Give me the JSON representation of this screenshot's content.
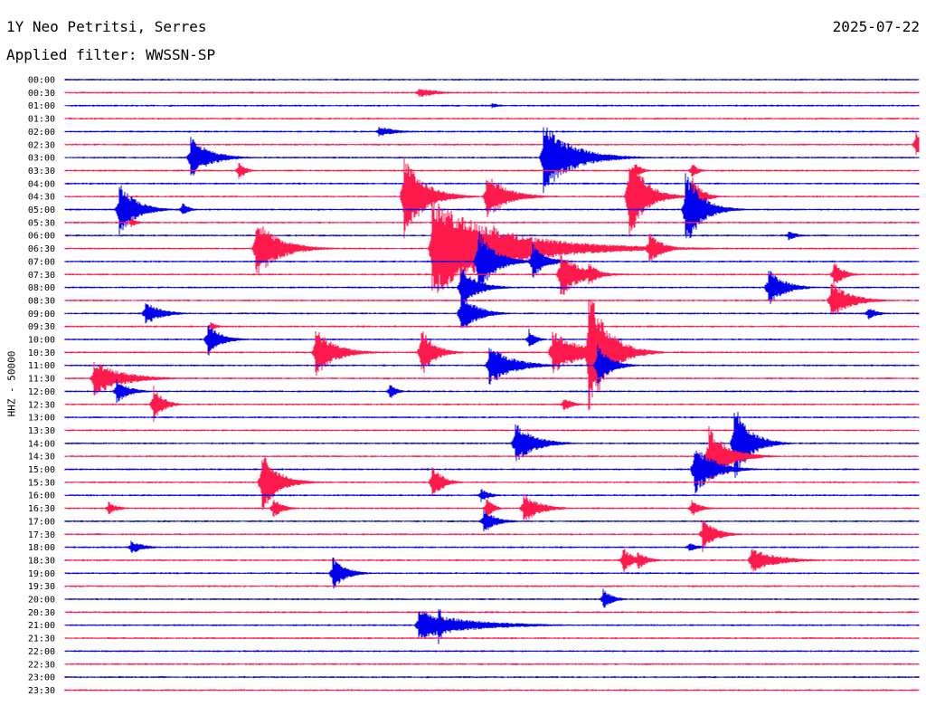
{
  "header": {
    "station": "1Y Neo Petritsi, Serres",
    "date": "2025-07-22",
    "filter_label": "Applied filter: WWSSN-SP"
  },
  "channel_label": "HHZ - 50000",
  "colors": {
    "blue_trace": "#0000ee",
    "red_trace": "#ff1a4d",
    "text": "#000000",
    "background": "#ffffff"
  },
  "chart_data": {
    "type": "line",
    "title": "1Y Neo Petritsi, Serres",
    "ylabel": "HHZ - 50000",
    "time_labels": [
      "00:00",
      "00:30",
      "01:00",
      "01:30",
      "02:00",
      "02:30",
      "03:00",
      "03:30",
      "04:00",
      "04:30",
      "05:00",
      "05:30",
      "06:00",
      "06:30",
      "07:00",
      "07:30",
      "08:00",
      "08:30",
      "09:00",
      "09:30",
      "10:00",
      "10:30",
      "11:00",
      "11:30",
      "12:00",
      "12:30",
      "13:00",
      "13:30",
      "14:00",
      "14:30",
      "15:00",
      "15:30",
      "16:00",
      "16:30",
      "17:00",
      "17:30",
      "18:00",
      "18:30",
      "19:00",
      "19:30",
      "20:00",
      "20:30",
      "21:00",
      "21:30",
      "22:00",
      "22:30",
      "23:00",
      "23:30"
    ],
    "trace_colors": [
      "blue_trace",
      "red_trace"
    ],
    "trace_minutes": 30,
    "events": [
      {
        "trace": 1,
        "minute": 12.4,
        "amp": 6,
        "dur": 1.2
      },
      {
        "trace": 2,
        "minute": 15.0,
        "amp": 3,
        "dur": 0.6
      },
      {
        "trace": 4,
        "minute": 11.0,
        "amp": 6,
        "dur": 1.2
      },
      {
        "trace": 5,
        "minute": 29.9,
        "amp": 18,
        "dur": 0.3
      },
      {
        "trace": 6,
        "minute": 4.4,
        "amp": 24,
        "dur": 1.2
      },
      {
        "trace": 6,
        "minute": 16.8,
        "amp": 40,
        "dur": 1.8
      },
      {
        "trace": 7,
        "minute": 6.1,
        "amp": 12,
        "dur": 0.4
      },
      {
        "trace": 7,
        "minute": 20.0,
        "amp": 12,
        "dur": 0.4
      },
      {
        "trace": 7,
        "minute": 22.0,
        "amp": 10,
        "dur": 0.4
      },
      {
        "trace": 9,
        "minute": 11.9,
        "amp": 50,
        "dur": 1.2
      },
      {
        "trace": 9,
        "minute": 14.8,
        "amp": 28,
        "dur": 1.2
      },
      {
        "trace": 9,
        "minute": 19.8,
        "amp": 55,
        "dur": 1.0
      },
      {
        "trace": 9,
        "minute": 22.0,
        "amp": 26,
        "dur": 0.6
      },
      {
        "trace": 10,
        "minute": 1.9,
        "amp": 32,
        "dur": 1.0
      },
      {
        "trace": 10,
        "minute": 4.1,
        "amp": 10,
        "dur": 0.4
      },
      {
        "trace": 10,
        "minute": 21.8,
        "amp": 45,
        "dur": 1.0
      },
      {
        "trace": 11,
        "minute": 2.3,
        "amp": 6,
        "dur": 0.4
      },
      {
        "trace": 12,
        "minute": 25.4,
        "amp": 6,
        "dur": 0.6
      },
      {
        "trace": 13,
        "minute": 6.7,
        "amp": 35,
        "dur": 1.4
      },
      {
        "trace": 13,
        "minute": 12.9,
        "amp": 55,
        "dur": 4.5
      },
      {
        "trace": 13,
        "minute": 15.0,
        "amp": 30,
        "dur": 1.2
      },
      {
        "trace": 13,
        "minute": 15.9,
        "amp": 16,
        "dur": 0.8
      },
      {
        "trace": 13,
        "minute": 20.5,
        "amp": 20,
        "dur": 0.8
      },
      {
        "trace": 14,
        "minute": 14.5,
        "amp": 40,
        "dur": 1.0
      },
      {
        "trace": 14,
        "minute": 16.4,
        "amp": 22,
        "dur": 0.8
      },
      {
        "trace": 15,
        "minute": 17.4,
        "amp": 28,
        "dur": 1.2
      },
      {
        "trace": 15,
        "minute": 18.4,
        "amp": 14,
        "dur": 0.6
      },
      {
        "trace": 15,
        "minute": 27.0,
        "amp": 16,
        "dur": 0.6
      },
      {
        "trace": 16,
        "minute": 13.9,
        "amp": 25,
        "dur": 1.0
      },
      {
        "trace": 16,
        "minute": 24.7,
        "amp": 22,
        "dur": 1.0
      },
      {
        "trace": 17,
        "minute": 26.9,
        "amp": 22,
        "dur": 1.2
      },
      {
        "trace": 18,
        "minute": 2.8,
        "amp": 14,
        "dur": 1.0
      },
      {
        "trace": 18,
        "minute": 13.9,
        "amp": 24,
        "dur": 1.0
      },
      {
        "trace": 18,
        "minute": 28.2,
        "amp": 8,
        "dur": 0.6
      },
      {
        "trace": 19,
        "minute": 5.1,
        "amp": 6,
        "dur": 0.4
      },
      {
        "trace": 20,
        "minute": 5.0,
        "amp": 20,
        "dur": 0.8
      },
      {
        "trace": 20,
        "minute": 16.3,
        "amp": 12,
        "dur": 0.4
      },
      {
        "trace": 21,
        "minute": 8.8,
        "amp": 28,
        "dur": 1.2
      },
      {
        "trace": 21,
        "minute": 12.5,
        "amp": 30,
        "dur": 0.8
      },
      {
        "trace": 21,
        "minute": 17.1,
        "amp": 25,
        "dur": 1.8
      },
      {
        "trace": 21,
        "minute": 18.4,
        "amp": 75,
        "dur": 1.2
      },
      {
        "trace": 22,
        "minute": 14.9,
        "amp": 24,
        "dur": 1.4
      },
      {
        "trace": 22,
        "minute": 18.7,
        "amp": 25,
        "dur": 0.8
      },
      {
        "trace": 23,
        "minute": 1.0,
        "amp": 20,
        "dur": 1.8
      },
      {
        "trace": 24,
        "minute": 1.8,
        "amp": 14,
        "dur": 0.8
      },
      {
        "trace": 24,
        "minute": 11.4,
        "amp": 10,
        "dur": 0.4
      },
      {
        "trace": 25,
        "minute": 3.1,
        "amp": 22,
        "dur": 0.6
      },
      {
        "trace": 25,
        "minute": 17.5,
        "amp": 8,
        "dur": 0.6
      },
      {
        "trace": 28,
        "minute": 15.8,
        "amp": 24,
        "dur": 1.2
      },
      {
        "trace": 28,
        "minute": 23.5,
        "amp": 45,
        "dur": 1.0
      },
      {
        "trace": 29,
        "minute": 22.6,
        "amp": 35,
        "dur": 1.2
      },
      {
        "trace": 30,
        "minute": 22.1,
        "amp": 30,
        "dur": 1.2
      },
      {
        "trace": 31,
        "minute": 6.9,
        "amp": 36,
        "dur": 1.0
      },
      {
        "trace": 31,
        "minute": 12.9,
        "amp": 22,
        "dur": 0.6
      },
      {
        "trace": 32,
        "minute": 14.6,
        "amp": 8,
        "dur": 0.6
      },
      {
        "trace": 33,
        "minute": 1.5,
        "amp": 8,
        "dur": 0.6
      },
      {
        "trace": 33,
        "minute": 7.3,
        "amp": 12,
        "dur": 0.6
      },
      {
        "trace": 33,
        "minute": 14.8,
        "amp": 14,
        "dur": 0.4
      },
      {
        "trace": 33,
        "minute": 16.1,
        "amp": 18,
        "dur": 1.0
      },
      {
        "trace": 33,
        "minute": 22.0,
        "amp": 10,
        "dur": 0.6
      },
      {
        "trace": 34,
        "minute": 14.7,
        "amp": 14,
        "dur": 0.8
      },
      {
        "trace": 35,
        "minute": 22.4,
        "amp": 20,
        "dur": 0.8
      },
      {
        "trace": 36,
        "minute": 2.3,
        "amp": 8,
        "dur": 0.8
      },
      {
        "trace": 36,
        "minute": 21.9,
        "amp": 6,
        "dur": 0.6
      },
      {
        "trace": 37,
        "minute": 19.6,
        "amp": 16,
        "dur": 0.6
      },
      {
        "trace": 37,
        "minute": 20.1,
        "amp": 12,
        "dur": 0.6
      },
      {
        "trace": 37,
        "minute": 24.1,
        "amp": 14,
        "dur": 1.6
      },
      {
        "trace": 38,
        "minute": 9.4,
        "amp": 20,
        "dur": 0.8
      },
      {
        "trace": 40,
        "minute": 18.9,
        "amp": 12,
        "dur": 0.6
      },
      {
        "trace": 42,
        "minute": 12.4,
        "amp": 16,
        "dur": 3.3
      },
      {
        "trace": 42,
        "minute": 13.1,
        "amp": 28,
        "dur": 0.4
      }
    ]
  }
}
